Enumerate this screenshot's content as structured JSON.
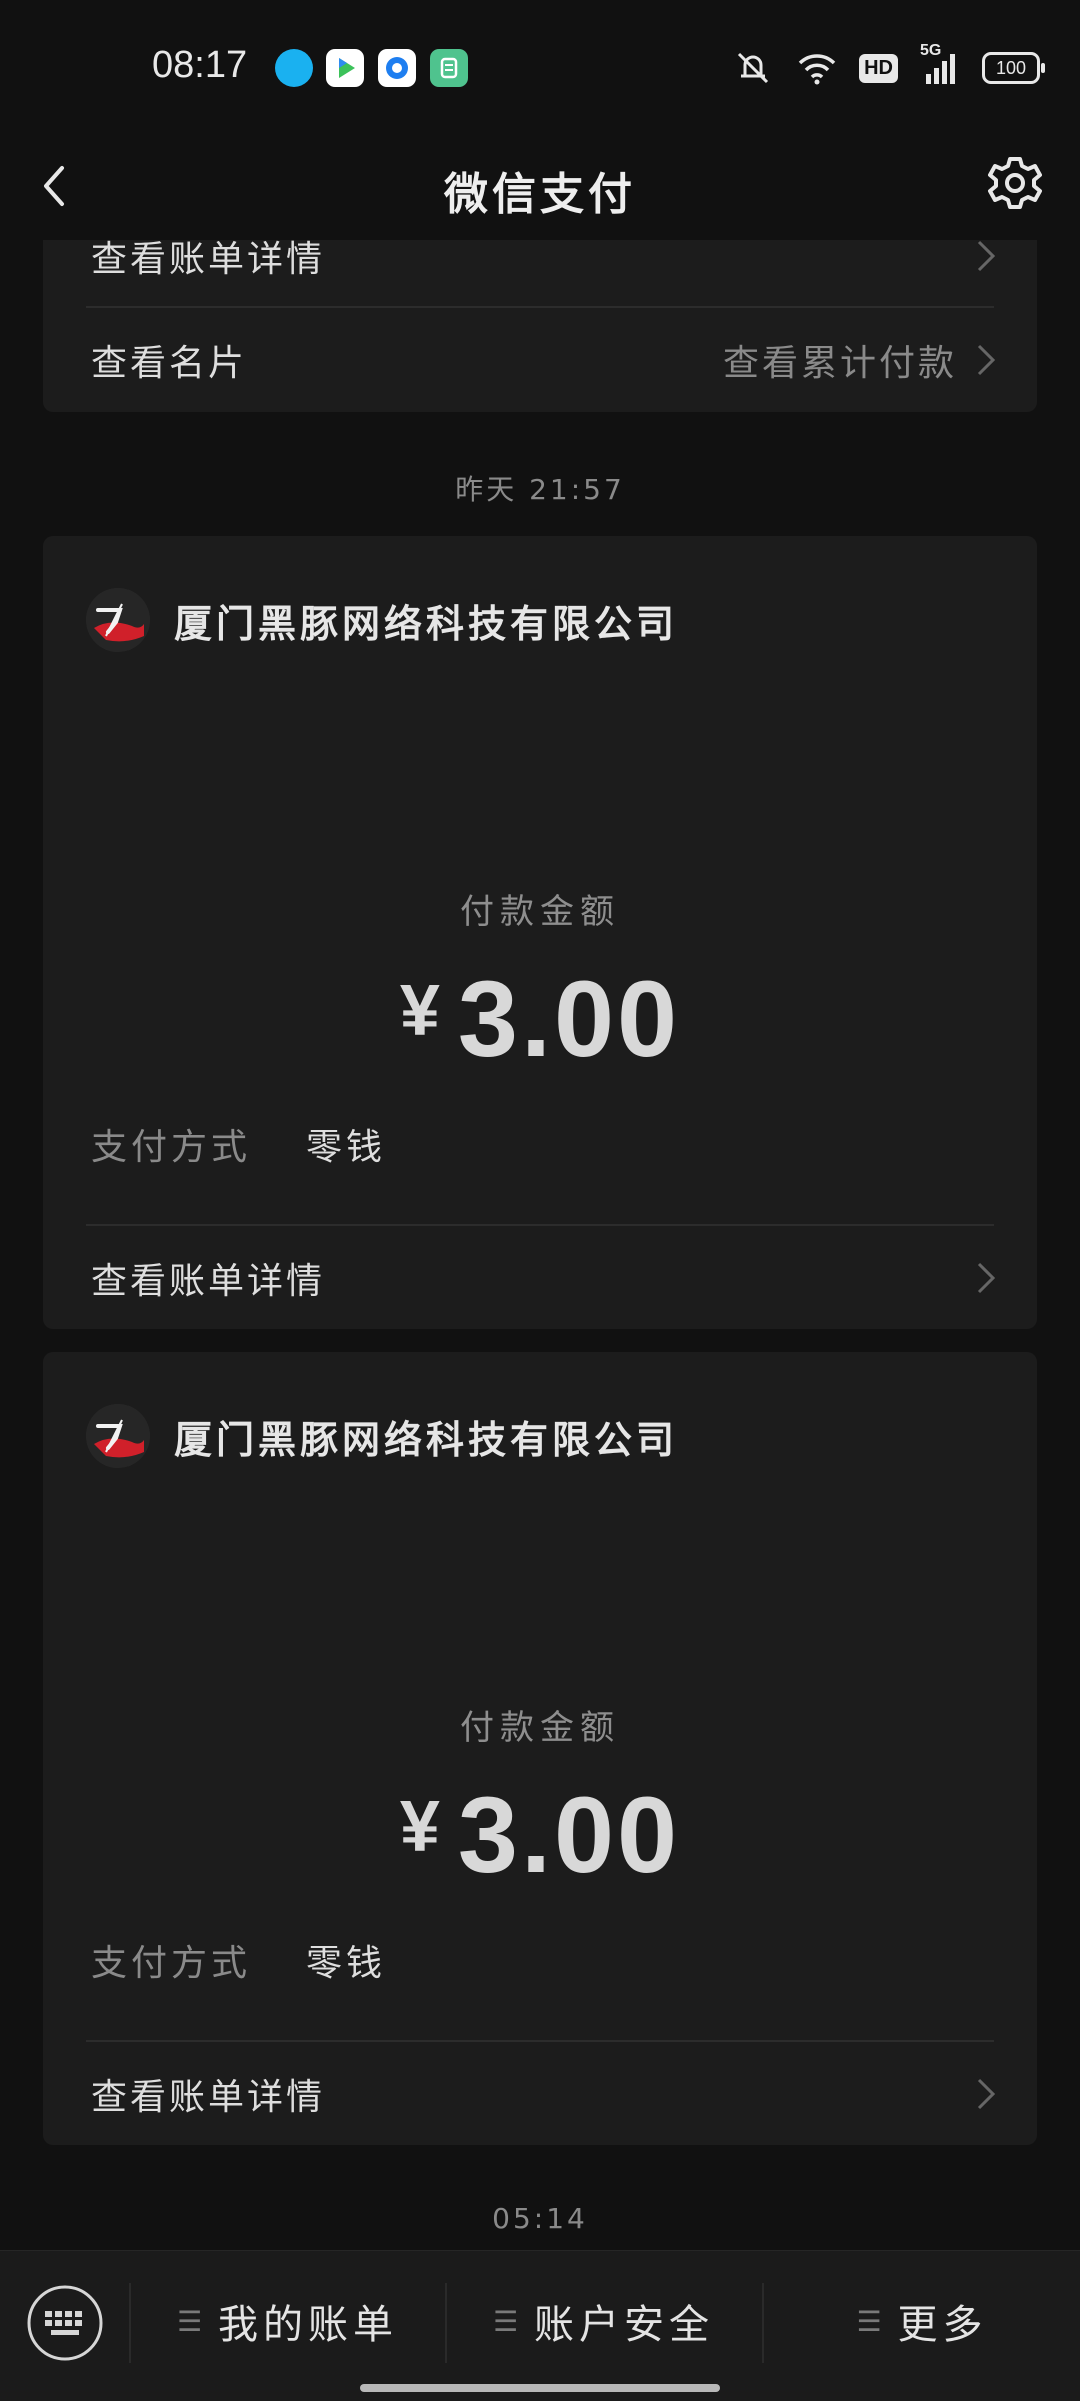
{
  "status_bar": {
    "time": "08:17",
    "network": "5G",
    "hd": "HD",
    "battery": "100",
    "icons": [
      "qq-icon",
      "video-icon",
      "browser-icon",
      "green-app-icon",
      "mute-icon",
      "wifi-icon",
      "signal-icon"
    ]
  },
  "header": {
    "title": "微信支付"
  },
  "top_card": {
    "row1": "查看账单详情",
    "row2_label": "查看名片",
    "row2_right": "查看累计付款"
  },
  "timestamps": [
    "昨天 21:57",
    "05:14"
  ],
  "payments": [
    {
      "merchant": "厦门黑豚网络科技有限公司",
      "amount_label": "付款金额",
      "currency": "¥",
      "amount": "3.00",
      "method_label": "支付方式",
      "method": "零钱",
      "detail_link": "查看账单详情"
    },
    {
      "merchant": "厦门黑豚网络科技有限公司",
      "amount_label": "付款金额",
      "currency": "¥",
      "amount": "3.00",
      "method_label": "支付方式",
      "method": "零钱",
      "detail_link": "查看账单详情"
    }
  ],
  "bottom_menu": {
    "items": [
      "我的账单",
      "账户安全",
      "更多"
    ]
  },
  "colors": {
    "background": "#111111",
    "card": "#1c1c1c",
    "text": "#dedede",
    "muted": "#8a8a8a",
    "logo_red": "#d0202a"
  }
}
